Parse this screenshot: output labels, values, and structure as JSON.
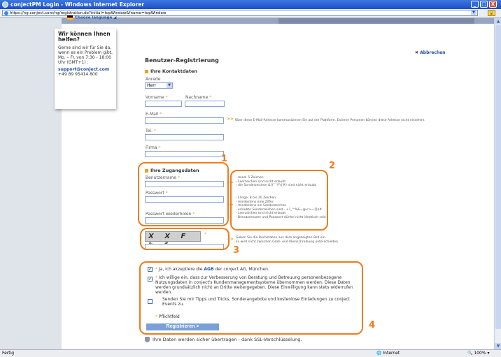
{
  "window": {
    "title": "conjectPM Login - Windows Internet Explorer",
    "min": "_",
    "max": "□",
    "close": "X"
  },
  "address": {
    "url": "https://ng.conject.com/ng/registration.do?initial=topWindow&fname=topWindow"
  },
  "language": {
    "label": "Choose language"
  },
  "help": {
    "title": "Wir können Ihnen helfen?",
    "text": "Gerne sind wir für Sie da, wenn es ein Problem gibt, Mo. – Fr. von 7:30 - 18:00 Uhr (GMT+1) :",
    "email": "support@conject.com",
    "phone": "+49 89 95414 800"
  },
  "form": {
    "title": "Benutzer-Registrierung",
    "cancel": "Abbrechen",
    "contact_section": "Ihre Kontaktdaten",
    "salutation_label": "Anrede",
    "salutation_value": "Herr",
    "firstname_label": "Vorname",
    "lastname_label": "Nachname",
    "email_label": "E-Mail",
    "email_hint": "Über diese E-Mail-Adresse kommunizieren Sie auf der Plattform. Externe Personen können diese Adresse nicht einsehen.",
    "phone_label": "Tel.",
    "company_label": "Firma",
    "access_section": "Ihre Zugangsdaten",
    "username_label": "Benutzername",
    "username_hint": [
      "- mind. 5 Zeichen",
      "- Leerzeichen sind nicht erlaubt",
      "- die Sonderzeichen &()\"`'/?\\{#} sind nicht erlaubt"
    ],
    "password_label": "Passwort",
    "password_hint": [
      "- Länge: 8 bis 20 Zeichen",
      "- mindestens eine Ziffer",
      "- mindestens ein Sonderzeichen",
      "- erlaubte Sonderzeichen sind - +?_^%&=@<>~;[]$#",
      "- Leerzeichen sind nicht erlaubt",
      "- Benutzername und Passwort dürfen nicht identisch sein"
    ],
    "password_repeat_label": "Passwort wiederholen",
    "captcha_text": "X X F b f",
    "captcha_hint": [
      "Geben Sie die Buchstaben aus dem angezeigten Bild ein.",
      "Es wird nicht zwischen Groß- und Kleinschreibung unterschieden."
    ],
    "agb_prefix": "Ja, ich akzeptiere die",
    "agb_link": "AGB",
    "agb_suffix": "der conject AG, München.",
    "consent_text": "Ich willige ein, dass zur Verbesserung von Beratung und Betreuung personenbezogene Nutzungsdaten in conject's Kundenmanagementsysteme übernommen werden. Diese Daten werden grundsätzlich nicht an Dritte weitergegeben. Diese Einwilligung kann stets widerrufen werden.",
    "newsletter_text": "Senden Sie mir Tipps und Tricks, Sonderangebote und kostenlose Einladungen zu conject Events zu.",
    "required_note": "Pflichtfeld",
    "register_button": "Registrieren >",
    "ssl_text": "Ihre Daten werden sicher übertragen - dank SSL-Verschlüsselung."
  },
  "annotations": [
    "1",
    "2",
    "3",
    "4"
  ],
  "status": {
    "left": "Fertig",
    "zone": "Internet",
    "zoom": "100%"
  }
}
